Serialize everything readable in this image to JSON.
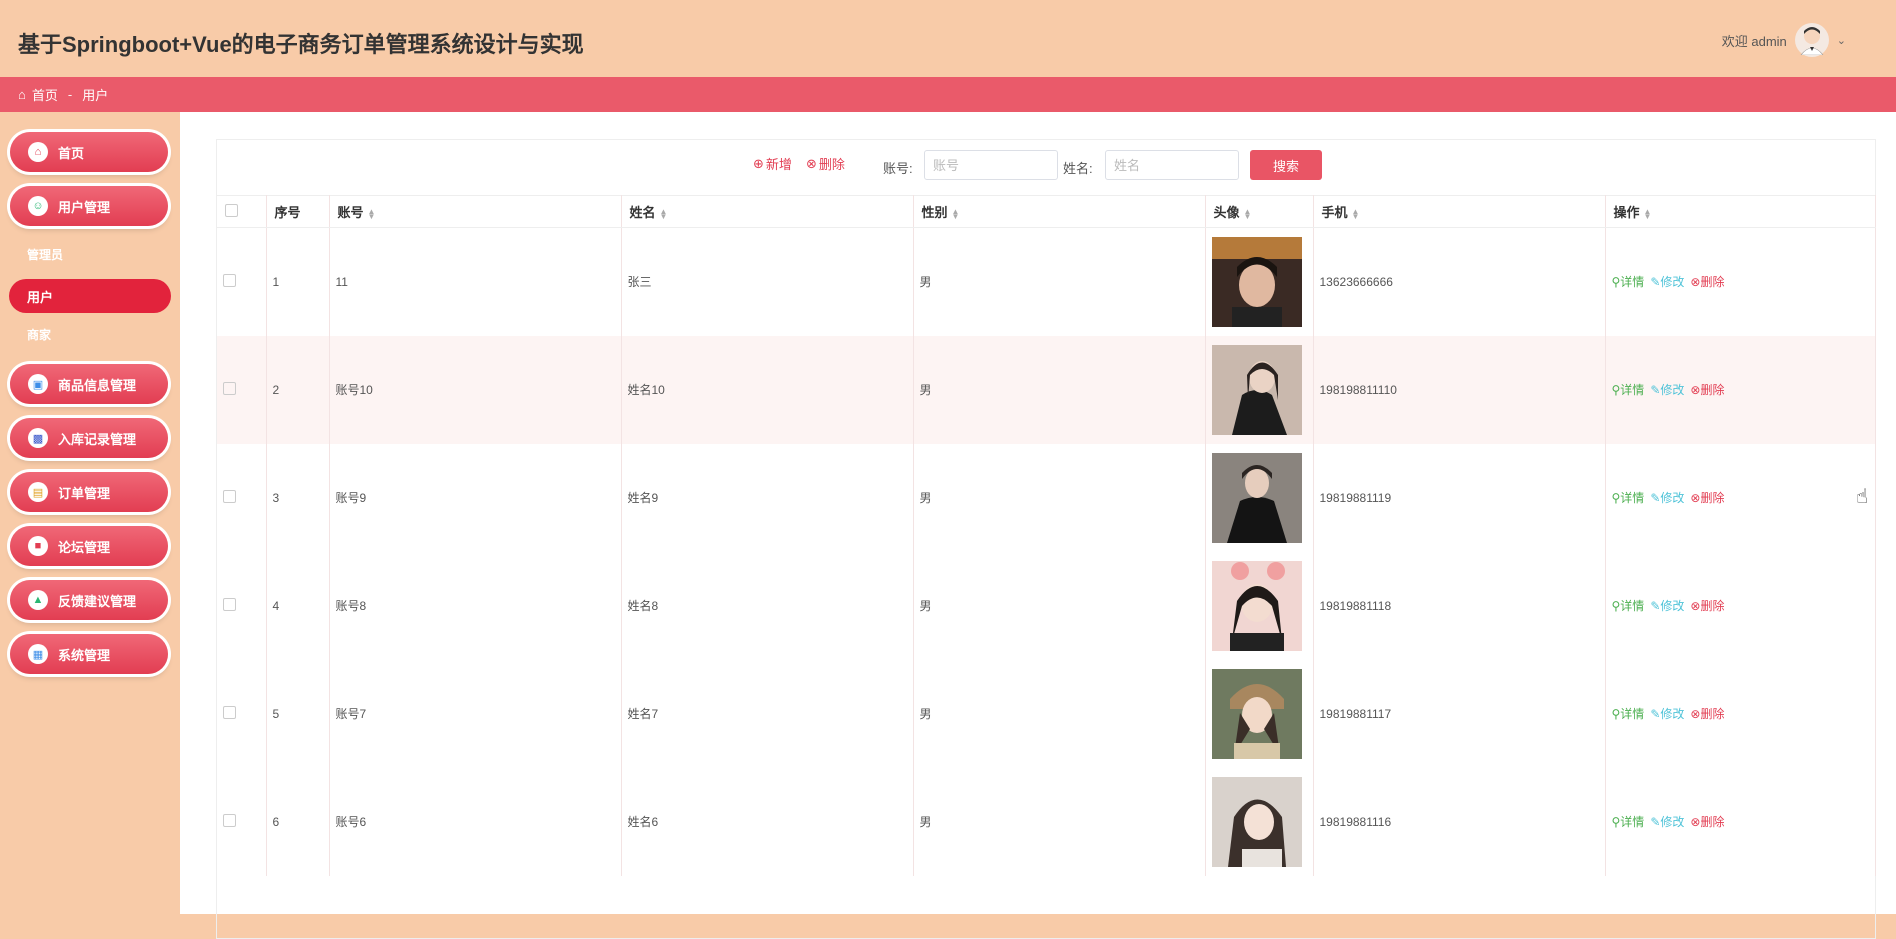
{
  "app": {
    "title": "基于Springboot+Vue的电子商务订单管理系统设计与实现",
    "welcome": "欢迎 admin"
  },
  "breadcrumb": {
    "home": "首页",
    "current": "用户"
  },
  "sidebar": {
    "items": [
      {
        "label": "首页",
        "icon": "home-icon"
      },
      {
        "label": "用户管理",
        "icon": "user-icon"
      },
      {
        "label": "商品信息管理",
        "icon": "card-icon"
      },
      {
        "label": "入库记录管理",
        "icon": "image-icon"
      },
      {
        "label": "订单管理",
        "icon": "bag-icon"
      },
      {
        "label": "论坛管理",
        "icon": "book-icon"
      },
      {
        "label": "反馈建议管理",
        "icon": "feedback-icon"
      },
      {
        "label": "系统管理",
        "icon": "grid-icon"
      }
    ],
    "subitems": [
      "管理员",
      "用户",
      "商家"
    ]
  },
  "toolbar": {
    "add": "新增",
    "delete": "删除",
    "account_label": "账号:",
    "account_placeholder": "账号",
    "name_label": "姓名:",
    "name_placeholder": "姓名",
    "search": "搜索"
  },
  "table": {
    "headers": [
      "序号",
      "账号",
      "姓名",
      "性别",
      "头像",
      "手机",
      "操作"
    ],
    "ops": {
      "detail": "详情",
      "edit": "修改",
      "delete": "删除"
    },
    "rows": [
      {
        "index": "1",
        "account": "11",
        "name": "张三",
        "gender": "男",
        "phone": "13623666666"
      },
      {
        "index": "2",
        "account": "账号10",
        "name": "姓名10",
        "gender": "男",
        "phone": "198198811110"
      },
      {
        "index": "3",
        "account": "账号9",
        "name": "姓名9",
        "gender": "男",
        "phone": "19819881119"
      },
      {
        "index": "4",
        "account": "账号8",
        "name": "姓名8",
        "gender": "男",
        "phone": "19819881118"
      },
      {
        "index": "5",
        "account": "账号7",
        "name": "姓名7",
        "gender": "男",
        "phone": "19819881117"
      },
      {
        "index": "6",
        "account": "账号6",
        "name": "姓名6",
        "gender": "男",
        "phone": "19819881116"
      }
    ]
  }
}
